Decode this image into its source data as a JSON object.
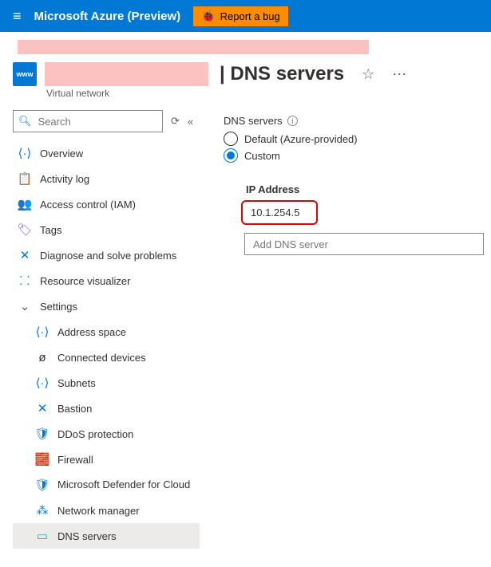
{
  "topbar": {
    "title": "Microsoft Azure (Preview)",
    "bug_label": "Report a bug"
  },
  "header": {
    "page_title": "| DNS servers",
    "subtitle": "Virtual network",
    "vnet_badge": "www"
  },
  "search": {
    "placeholder": "Search"
  },
  "nav": {
    "overview": "Overview",
    "activity": "Activity log",
    "iam": "Access control (IAM)",
    "tags": "Tags",
    "diagnose": "Diagnose and solve problems",
    "visualizer": "Resource visualizer",
    "settings": "Settings",
    "address_space": "Address space",
    "connected": "Connected devices",
    "subnets": "Subnets",
    "bastion": "Bastion",
    "ddos": "DDoS protection",
    "firewall": "Firewall",
    "defender": "Microsoft Defender for Cloud",
    "netmgr": "Network manager",
    "dns": "DNS servers"
  },
  "main": {
    "servers_label": "DNS servers",
    "option_default": "Default (Azure-provided)",
    "option_custom": "Custom",
    "ip_header": "IP Address",
    "ip_value": "10.1.254.5",
    "add_placeholder": "Add DNS server"
  }
}
